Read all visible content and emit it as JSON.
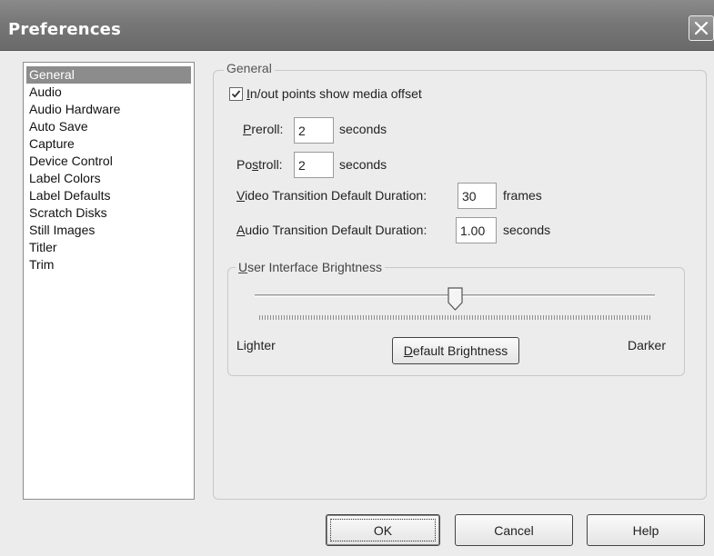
{
  "window": {
    "title": "Preferences",
    "close_icon": "close-icon"
  },
  "sidebar": {
    "items": [
      {
        "label": "General",
        "selected": true
      },
      {
        "label": "Audio",
        "selected": false
      },
      {
        "label": "Audio Hardware",
        "selected": false
      },
      {
        "label": "Auto Save",
        "selected": false
      },
      {
        "label": "Capture",
        "selected": false
      },
      {
        "label": "Device Control",
        "selected": false
      },
      {
        "label": "Label Colors",
        "selected": false
      },
      {
        "label": "Label Defaults",
        "selected": false
      },
      {
        "label": "Scratch Disks",
        "selected": false
      },
      {
        "label": "Still Images",
        "selected": false
      },
      {
        "label": "Titler",
        "selected": false
      },
      {
        "label": "Trim",
        "selected": false
      }
    ]
  },
  "general": {
    "legend": "General",
    "checkbox": {
      "label_mnemonic": "I",
      "label_rest": "n/out points show media offset",
      "checked": true
    },
    "preroll": {
      "label_mnemonic": "P",
      "label_rest": "reroll:",
      "value": "2",
      "unit": "seconds"
    },
    "postroll": {
      "label_pre": "Po",
      "label_mnemonic": "s",
      "label_rest": "troll:",
      "value": "2",
      "unit": "seconds"
    },
    "video_transition": {
      "label_mnemonic": "V",
      "label_rest": "ideo Transition Default Duration:",
      "value": "30",
      "unit": "frames"
    },
    "audio_transition": {
      "label_mnemonic": "A",
      "label_rest": "udio Transition Default Duration:",
      "value": "1.00",
      "unit": "seconds"
    },
    "brightness": {
      "legend_mnemonic": "U",
      "legend_rest": "ser Interface Brightness",
      "slider_value": 0.5,
      "lighter_label": "Lighter",
      "darker_label": "Darker",
      "default_button_mnemonic": "D",
      "default_button_rest": "efault Brightness"
    }
  },
  "buttons": {
    "ok": "OK",
    "cancel": "Cancel",
    "help": "Help"
  },
  "colors": {
    "titlebar": "#777777",
    "selection": "#8c8c8c",
    "background": "#ececec"
  }
}
